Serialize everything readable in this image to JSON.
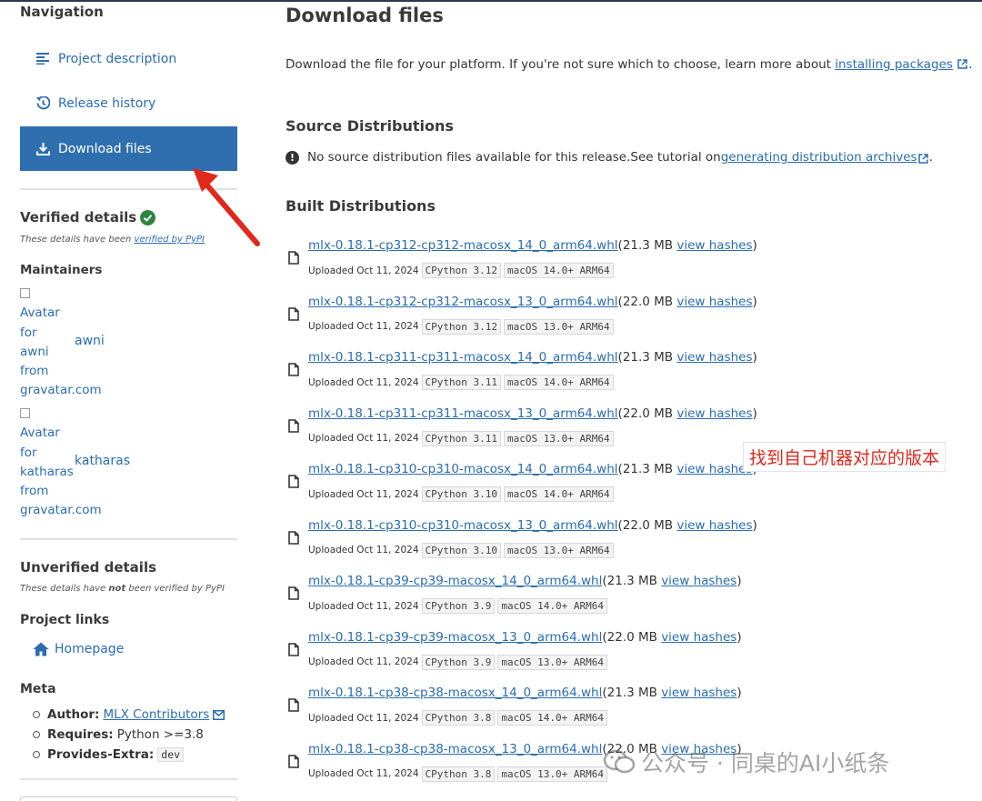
{
  "sidebar": {
    "heading": "Navigation",
    "nav": [
      {
        "label": "Project description",
        "icon": "align-left-icon"
      },
      {
        "label": "Release history",
        "icon": "history-icon"
      },
      {
        "label": "Download files",
        "icon": "download-icon",
        "active": true
      }
    ],
    "verified": {
      "title": "Verified details",
      "note_prefix": "These details have been ",
      "note_link": "verified by PyPI"
    },
    "maintainers": {
      "title": "Maintainers",
      "items": [
        {
          "alt": "Avatar for awni from gravatar.com",
          "name": "awni"
        },
        {
          "alt": "Avatar for katharas from gravatar.com",
          "name": "katharas"
        }
      ]
    },
    "unverified": {
      "title": "Unverified details",
      "note_prefix": "These details have ",
      "note_bold": "not",
      "note_suffix": " been verified by PyPI"
    },
    "project_links": {
      "title": "Project links",
      "homepage": "Homepage"
    },
    "meta": {
      "title": "Meta",
      "author_label": "Author:",
      "author_value": "MLX Contributors",
      "requires_label": "Requires:",
      "requires_value": "Python >=3.8",
      "extra_label": "Provides-Extra:",
      "extra_value": "dev"
    }
  },
  "main": {
    "title": "Download files",
    "intro_text": "Download the file for your platform. If you're not sure which to choose, learn more about ",
    "intro_link": "installing packages",
    "intro_end": ".",
    "source_title": "Source Distributions",
    "source_note": "No source distribution files available for this release.See tutorial on ",
    "source_link": "generating distribution archives",
    "source_end": ".",
    "built_title": "Built Distributions",
    "files": [
      {
        "name": "mlx-0.18.1-cp312-cp312-macosx_14_0_arm64.whl",
        "size": "(21.3 MB ",
        "hashes": "view hashes",
        "close": ")",
        "uploaded": "Uploaded Oct 11, 2024",
        "python": "CPython 3.12",
        "platform": "macOS 14.0+ ARM64"
      },
      {
        "name": "mlx-0.18.1-cp312-cp312-macosx_13_0_arm64.whl",
        "size": "(22.0 MB ",
        "hashes": "view hashes",
        "close": ")",
        "uploaded": "Uploaded Oct 11, 2024",
        "python": "CPython 3.12",
        "platform": "macOS 13.0+ ARM64"
      },
      {
        "name": "mlx-0.18.1-cp311-cp311-macosx_14_0_arm64.whl",
        "size": "(21.3 MB ",
        "hashes": "view hashes",
        "close": ")",
        "uploaded": "Uploaded Oct 11, 2024",
        "python": "CPython 3.11",
        "platform": "macOS 14.0+ ARM64"
      },
      {
        "name": "mlx-0.18.1-cp311-cp311-macosx_13_0_arm64.whl",
        "size": "(22.0 MB ",
        "hashes": "view hashes",
        "close": ")",
        "uploaded": "Uploaded Oct 11, 2024",
        "python": "CPython 3.11",
        "platform": "macOS 13.0+ ARM64"
      },
      {
        "name": "mlx-0.18.1-cp310-cp310-macosx_14_0_arm64.whl",
        "size": "(21.3 MB ",
        "hashes": "view hashes",
        "close": ")",
        "uploaded": "Uploaded Oct 11, 2024",
        "python": "CPython 3.10",
        "platform": "macOS 14.0+ ARM64"
      },
      {
        "name": "mlx-0.18.1-cp310-cp310-macosx_13_0_arm64.whl",
        "size": "(22.0 MB ",
        "hashes": "view hashes",
        "close": ")",
        "uploaded": "Uploaded Oct 11, 2024",
        "python": "CPython 3.10",
        "platform": "macOS 13.0+ ARM64"
      },
      {
        "name": "mlx-0.18.1-cp39-cp39-macosx_14_0_arm64.whl",
        "size": "(21.3 MB ",
        "hashes": "view hashes",
        "close": ")",
        "uploaded": "Uploaded Oct 11, 2024",
        "python": "CPython 3.9",
        "platform": "macOS 14.0+ ARM64"
      },
      {
        "name": "mlx-0.18.1-cp39-cp39-macosx_13_0_arm64.whl",
        "size": "(22.0 MB ",
        "hashes": "view hashes",
        "close": ")",
        "uploaded": "Uploaded Oct 11, 2024",
        "python": "CPython 3.9",
        "platform": "macOS 13.0+ ARM64"
      },
      {
        "name": "mlx-0.18.1-cp38-cp38-macosx_14_0_arm64.whl",
        "size": "(21.3 MB ",
        "hashes": "view hashes",
        "close": ")",
        "uploaded": "Uploaded Oct 11, 2024",
        "python": "CPython 3.8",
        "platform": "macOS 14.0+ ARM64"
      },
      {
        "name": "mlx-0.18.1-cp38-cp38-macosx_13_0_arm64.whl",
        "size": "(22.0 MB ",
        "hashes": "view hashes",
        "close": ")",
        "uploaded": "Uploaded Oct 11, 2024",
        "python": "CPython 3.8",
        "platform": "macOS 13.0+ ARM64"
      }
    ]
  },
  "annotation": {
    "text": "找到自己机器对应的版本",
    "color": "#e0281b"
  },
  "watermark": {
    "text": "公众号 · 同桌的AI小纸条"
  },
  "colors": {
    "link": "#2a6db0",
    "active_nav": "#2f6fb0",
    "verified": "#2e8540"
  }
}
